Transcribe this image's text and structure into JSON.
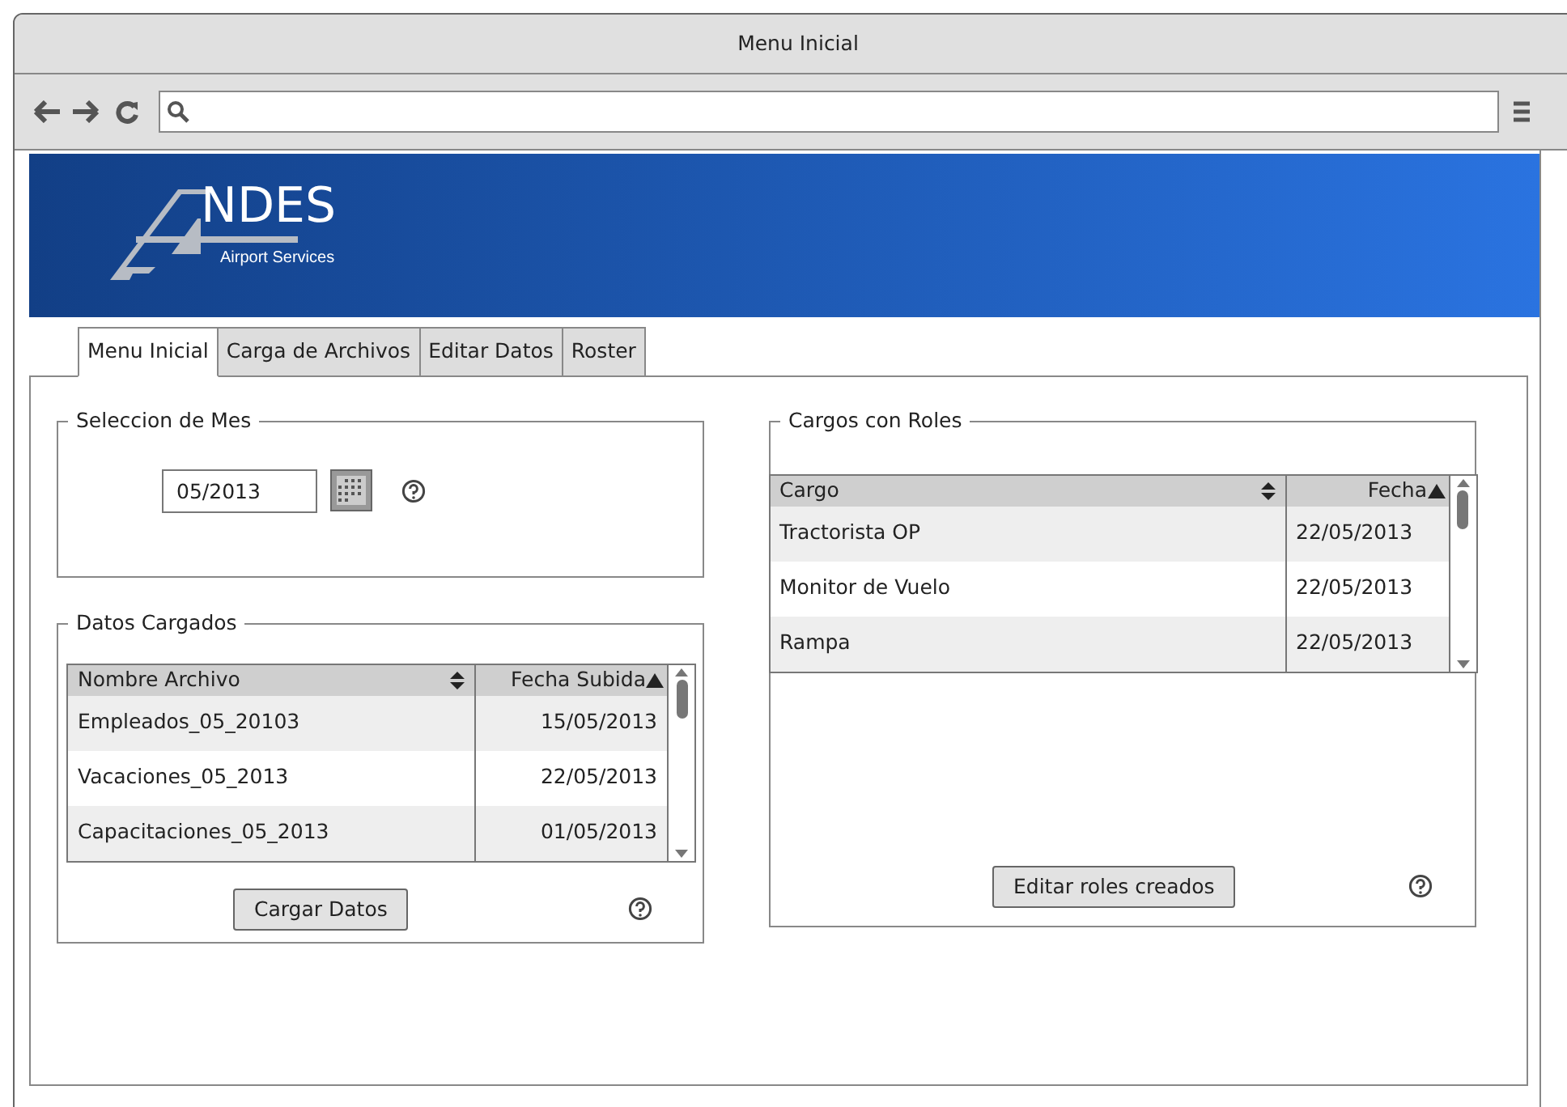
{
  "window": {
    "title": "Menu Inicial"
  },
  "logo": {
    "name": "NDES",
    "tagline": "Airport Services"
  },
  "tabs": [
    {
      "label": "Menu Inicial",
      "selected": true
    },
    {
      "label": "Carga de Archivos",
      "selected": false
    },
    {
      "label": "Editar Datos",
      "selected": false
    },
    {
      "label": "Roster",
      "selected": false
    }
  ],
  "month_selection": {
    "legend": "Seleccion de Mes",
    "value": "05/2013"
  },
  "uploaded_data": {
    "legend": "Datos Cargados",
    "columns": [
      "Nombre Archivo",
      "Fecha Subida"
    ],
    "rows": [
      [
        "Empleados_05_20103",
        "15/05/2013"
      ],
      [
        "Vacaciones_05_2013",
        "22/05/2013"
      ],
      [
        "Capacitaciones_05_2013",
        "01/05/2013"
      ]
    ],
    "button": "Cargar Datos"
  },
  "roles": {
    "legend": "Cargos con Roles",
    "columns": [
      "Cargo",
      "Fecha"
    ],
    "rows": [
      [
        "Tractorista OP",
        "22/05/2013"
      ],
      [
        "Monitor de Vuelo",
        "22/05/2013"
      ],
      [
        "Rampa",
        "22/05/2013"
      ]
    ],
    "button": "Editar roles creados"
  }
}
